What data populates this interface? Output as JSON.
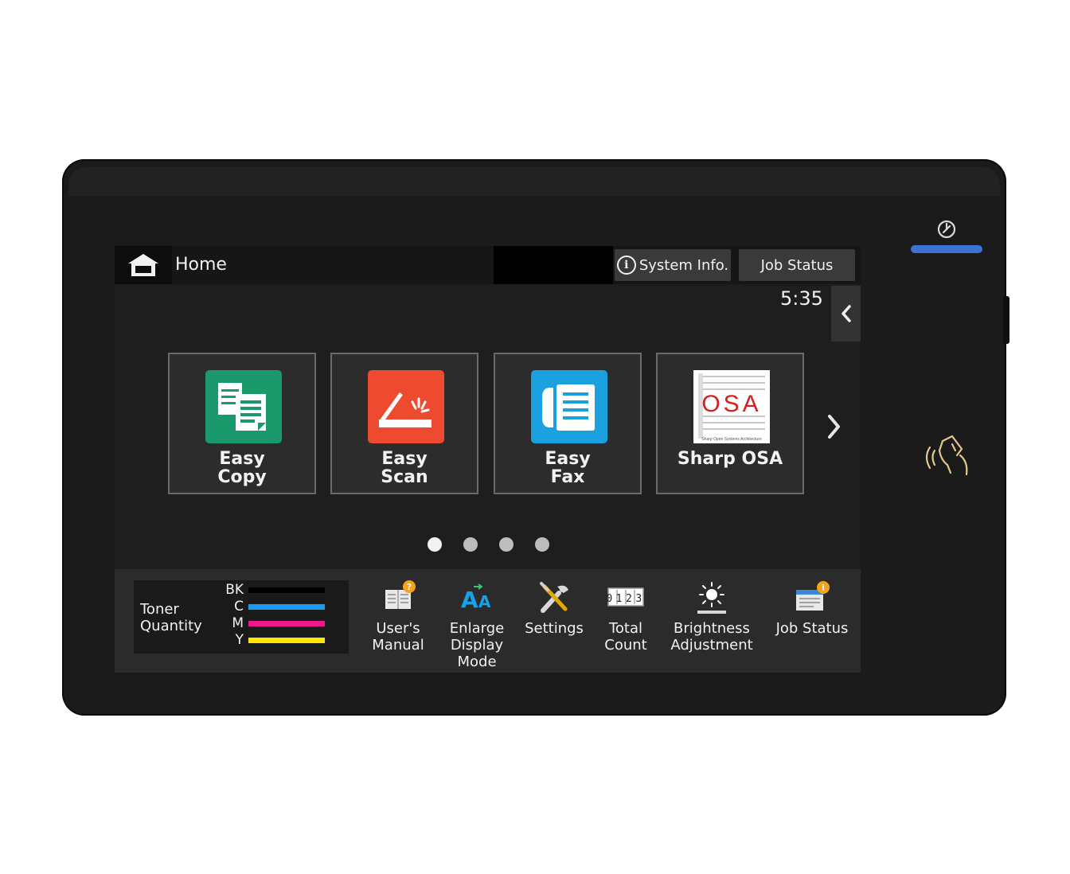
{
  "header": {
    "title": "Home",
    "system_info_label": "System Info.",
    "job_status_label": "Job Status",
    "time": "5:35"
  },
  "apps": [
    {
      "label_line1": "Easy",
      "label_line2": "Copy",
      "icon": "easy-copy-icon",
      "color": "#1a9a6c"
    },
    {
      "label_line1": "Easy",
      "label_line2": "Scan",
      "icon": "easy-scan-icon",
      "color": "#ee4a2f"
    },
    {
      "label_line1": "Easy",
      "label_line2": "Fax",
      "icon": "easy-fax-icon",
      "color": "#1ba0e0"
    },
    {
      "label_line1": "Sharp OSA",
      "label_line2": "",
      "icon": "sharp-osa-logo",
      "color": "#ffffff"
    }
  ],
  "pagination": {
    "pages": 4,
    "current": 1
  },
  "toner": {
    "label_line1": "Toner",
    "label_line2": "Quantity",
    "items": [
      {
        "code": "BK",
        "level": 1.0,
        "color": "#000000"
      },
      {
        "code": "C",
        "level": 1.0,
        "color": "#1a9bf0"
      },
      {
        "code": "M",
        "level": 1.0,
        "color": "#ee1a8a"
      },
      {
        "code": "Y",
        "level": 1.0,
        "color": "#ffe600"
      }
    ]
  },
  "shortcuts": [
    {
      "line1": "User's",
      "line2": "Manual",
      "line3": "",
      "icon": "users-manual-icon"
    },
    {
      "line1": "Enlarge",
      "line2": "Display",
      "line3": "Mode",
      "icon": "enlarge-display-icon"
    },
    {
      "line1": "Settings",
      "line2": "",
      "line3": "",
      "icon": "settings-icon"
    },
    {
      "line1": "Total",
      "line2": "Count",
      "line3": "",
      "icon": "total-count-icon"
    },
    {
      "line1": "Brightness",
      "line2": "Adjustment",
      "line3": "",
      "icon": "brightness-icon"
    },
    {
      "line1": "Job Status",
      "line2": "",
      "line3": "",
      "icon": "job-status-icon"
    }
  ],
  "total_count_digits": "0123",
  "osa_logo_text": "OSA",
  "osa_logo_caption": "Sharp Open Systems Architecture",
  "colors": {
    "power_led": "#3b74d6",
    "nfc": "#e2c88a",
    "badge": "#f5a31a"
  }
}
